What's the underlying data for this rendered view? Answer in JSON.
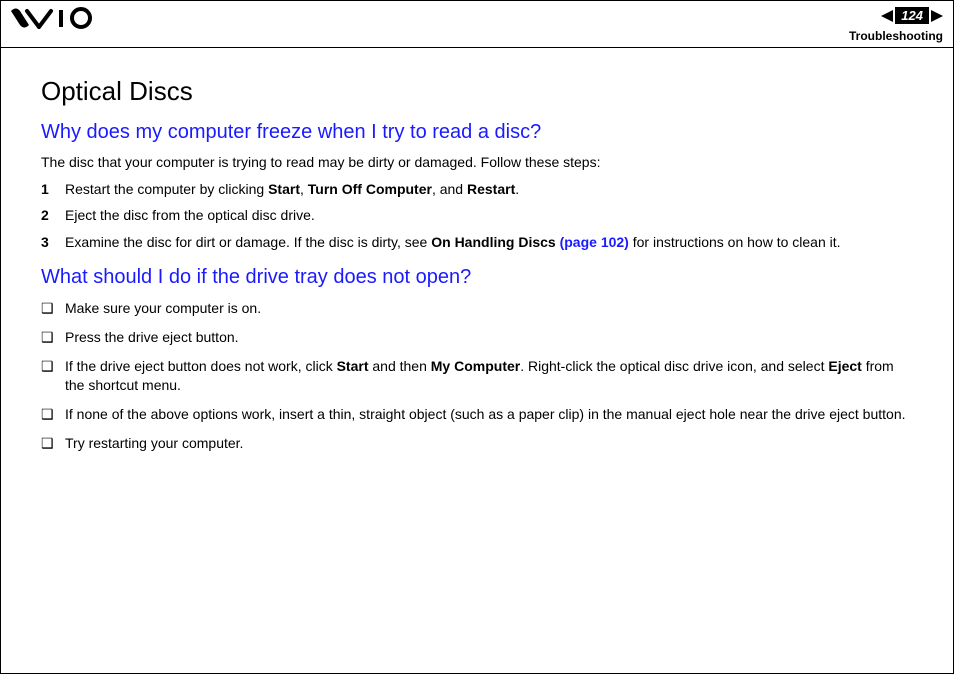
{
  "header": {
    "page_number": "124",
    "section": "Troubleshooting"
  },
  "content": {
    "title": "Optical Discs",
    "q1": {
      "heading": "Why does my computer freeze when I try to read a disc?",
      "intro": "The disc that your computer is trying to read may be dirty or damaged. Follow these steps:",
      "steps": {
        "s1a": "Restart the computer by clicking ",
        "s1b": "Start",
        "s1c": ", ",
        "s1d": "Turn Off Computer",
        "s1e": ", and ",
        "s1f": "Restart",
        "s1g": ".",
        "s2": "Eject the disc from the optical disc drive.",
        "s3a": "Examine the disc for dirt or damage. If the disc is dirty, see ",
        "s3b": "On Handling Discs ",
        "s3c": "(page 102)",
        "s3d": " for instructions on how to clean it."
      }
    },
    "q2": {
      "heading": "What should I do if the drive tray does not open?",
      "items": {
        "i1": "Make sure your computer is on.",
        "i2": "Press the drive eject button.",
        "i3a": "If the drive eject button does not work, click ",
        "i3b": "Start",
        "i3c": " and then ",
        "i3d": "My Computer",
        "i3e": ". Right-click the optical disc drive icon, and select ",
        "i3f": "Eject",
        "i3g": " from the shortcut menu.",
        "i4": "If none of the above options work, insert a thin, straight object (such as a paper clip) in the manual eject hole near the drive eject button.",
        "i5": "Try restarting your computer."
      }
    }
  }
}
